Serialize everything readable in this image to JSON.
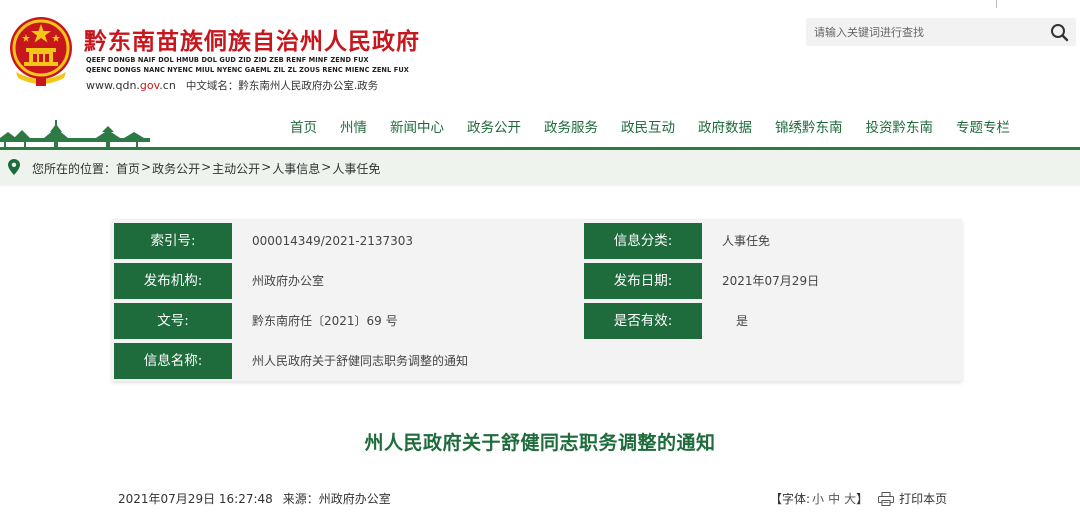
{
  "header": {
    "site_title": "黔东南苗族侗族自治州人民政府",
    "translit_line1": "QEEF DONGB NAIF DOL HMUB DOL GUD ZID ZID ZEB RENF MINF ZEND FUX",
    "translit_line2": "QEENC DONGS NANC NYENC MIUL NYENC GAEML ZIL ZL ZOUS RENC MIENC ZENL FUX",
    "domain_prefix": "www.qdn.",
    "domain_gov": "gov",
    "domain_suffix": ".cn",
    "cn_domain": "中文域名：黔东南州人民政府办公室.政务"
  },
  "search": {
    "placeholder": "请输入关键词进行查找"
  },
  "nav": {
    "items": [
      "首页",
      "州情",
      "新闻中心",
      "政务公开",
      "政务服务",
      "政民互动",
      "政府数据",
      "锦绣黔东南",
      "投资黔东南",
      "专题专栏"
    ]
  },
  "breadcrumb": {
    "prefix": "您所在的位置：",
    "items": [
      "首页",
      "政务公开",
      "主动公开",
      "人事信息",
      "人事任免"
    ],
    "separator": ">"
  },
  "info": {
    "index_label": "索引号:",
    "index_value": "000014349/2021-2137303",
    "category_label": "信息分类:",
    "category_value": "人事任免",
    "publisher_label": "发布机构:",
    "publisher_value": "州政府办公室",
    "date_label": "发布日期:",
    "date_value": "2021年07月29日",
    "docno_label": "文号:",
    "docno_value": "黔东南府任〔2021〕69 号",
    "valid_label": "是否有效:",
    "valid_value": "是",
    "name_label": "信息名称:",
    "name_value": "州人民政府关于舒健同志职务调整的通知"
  },
  "article": {
    "title": "州人民政府关于舒健同志职务调整的通知",
    "datetime": "2021年07月29日 16:27:48",
    "source": "来源：州政府办公室",
    "font_label": "【字体:",
    "font_small": "小",
    "font_medium": "中",
    "font_large": "大",
    "font_close": "】",
    "print": "打印本页"
  },
  "colors": {
    "brand_red": "#c8161d",
    "brand_green": "#1e6b3b"
  }
}
